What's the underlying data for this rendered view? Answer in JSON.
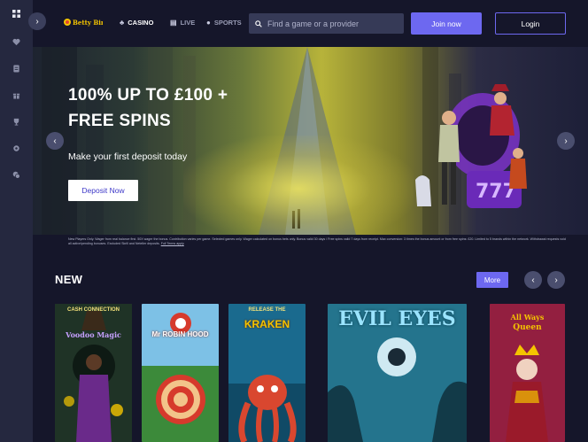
{
  "sidebar": {
    "items": [
      {
        "icon": "grid-icon"
      },
      {
        "icon": "heart-icon"
      },
      {
        "icon": "document-icon"
      },
      {
        "icon": "gift-icon"
      },
      {
        "icon": "trophy-icon"
      },
      {
        "icon": "settings-icon"
      },
      {
        "icon": "chat-icon"
      }
    ]
  },
  "header": {
    "logo_text": "Betty Bingo",
    "nav": {
      "casino": "CASINO",
      "live": "LIVE",
      "sports": "SPORTS"
    },
    "search_placeholder": "Find a game or a provider",
    "join_label": "Join now",
    "login_label": "Login"
  },
  "hero": {
    "title_line1": "100% UP TO £100 +",
    "title_line2": "FREE SPINS",
    "subtitle": "Make your first deposit today",
    "cta_label": "Deposit Now"
  },
  "terms": {
    "text": "New Players Only. Wager from real balance first. 50X wager the bonus. Contribution varies per game. Selected games only. Wager calculated on bonus bets only. Bonus valid 30 days / Free spins valid 7 days from receipt. Max conversion: 3 times the bonus amount or from free spins: £20. Limited to 5 brands within the network. Withdrawal requests void all active/pending bonuses. Excluded Skrill and Neteller deposits.",
    "link_label": "Full Terms apply"
  },
  "new_section": {
    "title": "NEW",
    "more_label": "More",
    "games": [
      {
        "title_line1": "CASH CONNECTION",
        "title_line2": "Voodoo Magic",
        "accent": "#7a3fd0"
      },
      {
        "title_line1": "",
        "title_line2": "Mr ROBIN HOOD",
        "accent": "#d63a2c"
      },
      {
        "title_line1": "RELEASE THE",
        "title_line2": "KRAKEN",
        "accent": "#d9472f"
      },
      {
        "title_line1": "",
        "title_line2": "EVIL EYES",
        "accent": "#2fa6c8"
      },
      {
        "title_line1": "All Ways",
        "title_line2": "Queen",
        "accent": "#c42a4e"
      }
    ]
  },
  "colors": {
    "accent": "#6d68f0",
    "background": "#15162a",
    "sidebar": "#25283f"
  }
}
